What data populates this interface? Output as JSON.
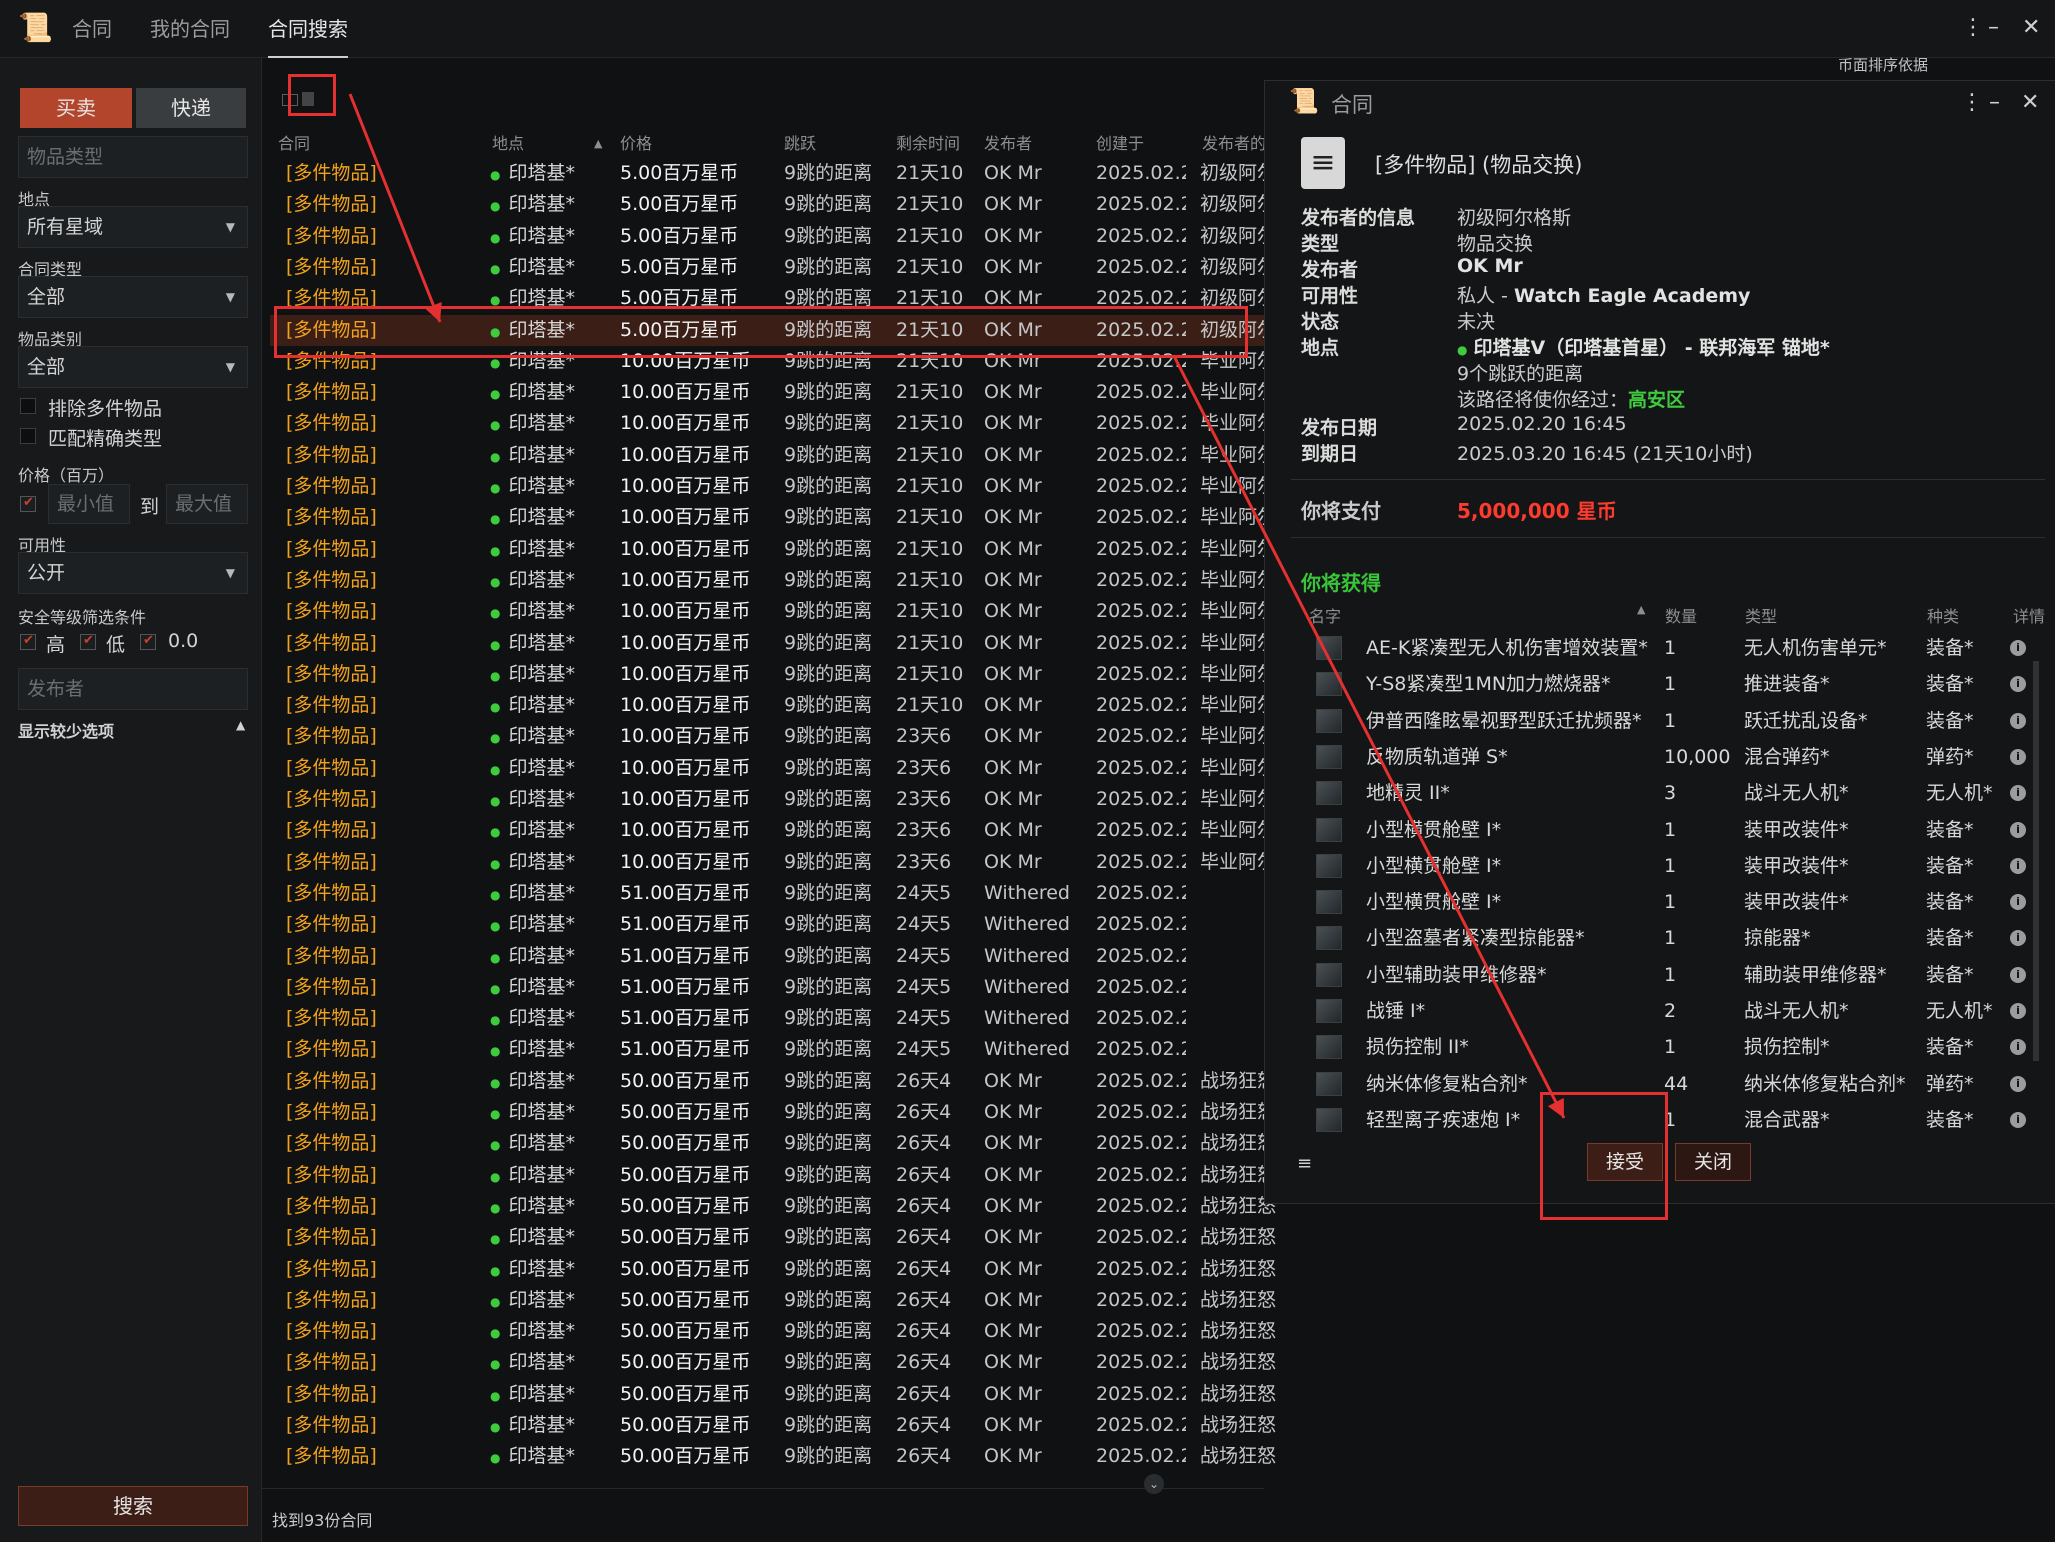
{
  "app": {
    "tabs": [
      "合同",
      "我的合同",
      "合同搜索"
    ],
    "window_controls": [
      "⋮",
      "–",
      "✕"
    ],
    "sort_hint": "币面排序依据"
  },
  "sidebar": {
    "mode_buy": "买卖",
    "mode_courier": "快递",
    "item_type_placeholder": "物品类型",
    "location_label": "地点",
    "location_value": "所有星域",
    "contract_type_label": "合同类型",
    "contract_type_value": "全部",
    "item_category_label": "物品类别",
    "item_category_value": "全部",
    "exclude_multi": "排除多件物品",
    "exact_match": "匹配精确类型",
    "price_label": "价格（百万）",
    "price_min_placeholder": "最小值",
    "price_to": "到",
    "price_max_placeholder": "最大值",
    "availability_label": "可用性",
    "availability_value": "公开",
    "security_label": "安全等级筛选条件",
    "sec_high": "高",
    "sec_low": "低",
    "sec_null": "0.0",
    "issuer_placeholder": "发布者",
    "fewer_options": "显示较少选项",
    "search_button": "搜索"
  },
  "table": {
    "headers": [
      "合同",
      "地点",
      "价格",
      "跳跃",
      "剩余时间",
      "发布者",
      "创建于",
      "发布者的"
    ],
    "rows": [
      [
        "[多件物品]",
        "印塔基*",
        "5.00百万星币",
        "9跳的距离",
        "21天10",
        "OK Mr",
        "2025.02.2",
        "初级阿尔"
      ],
      [
        "[多件物品]",
        "印塔基*",
        "5.00百万星币",
        "9跳的距离",
        "21天10",
        "OK Mr",
        "2025.02.2",
        "初级阿尔"
      ],
      [
        "[多件物品]",
        "印塔基*",
        "5.00百万星币",
        "9跳的距离",
        "21天10",
        "OK Mr",
        "2025.02.2",
        "初级阿尔"
      ],
      [
        "[多件物品]",
        "印塔基*",
        "5.00百万星币",
        "9跳的距离",
        "21天10",
        "OK Mr",
        "2025.02.2",
        "初级阿尔"
      ],
      [
        "[多件物品]",
        "印塔基*",
        "5.00百万星币",
        "9跳的距离",
        "21天10",
        "OK Mr",
        "2025.02.2",
        "初级阿尔"
      ],
      [
        "[多件物品]",
        "印塔基*",
        "5.00百万星币",
        "9跳的距离",
        "21天10",
        "OK Mr",
        "2025.02.2",
        "初级阿尔"
      ],
      [
        "[多件物品]",
        "印塔基*",
        "10.00百万星币",
        "9跳的距离",
        "21天10",
        "OK Mr",
        "2025.02.2",
        "毕业阿尔"
      ],
      [
        "[多件物品]",
        "印塔基*",
        "10.00百万星币",
        "9跳的距离",
        "21天10",
        "OK Mr",
        "2025.02.2",
        "毕业阿尔"
      ],
      [
        "[多件物品]",
        "印塔基*",
        "10.00百万星币",
        "9跳的距离",
        "21天10",
        "OK Mr",
        "2025.02.2",
        "毕业阿尔"
      ],
      [
        "[多件物品]",
        "印塔基*",
        "10.00百万星币",
        "9跳的距离",
        "21天10",
        "OK Mr",
        "2025.02.2",
        "毕业阿尔"
      ],
      [
        "[多件物品]",
        "印塔基*",
        "10.00百万星币",
        "9跳的距离",
        "21天10",
        "OK Mr",
        "2025.02.2",
        "毕业阿尔"
      ],
      [
        "[多件物品]",
        "印塔基*",
        "10.00百万星币",
        "9跳的距离",
        "21天10",
        "OK Mr",
        "2025.02.2",
        "毕业阿尔"
      ],
      [
        "[多件物品]",
        "印塔基*",
        "10.00百万星币",
        "9跳的距离",
        "21天10",
        "OK Mr",
        "2025.02.2",
        "毕业阿尔"
      ],
      [
        "[多件物品]",
        "印塔基*",
        "10.00百万星币",
        "9跳的距离",
        "21天10",
        "OK Mr",
        "2025.02.2",
        "毕业阿尔"
      ],
      [
        "[多件物品]",
        "印塔基*",
        "10.00百万星币",
        "9跳的距离",
        "21天10",
        "OK Mr",
        "2025.02.2",
        "毕业阿尔"
      ],
      [
        "[多件物品]",
        "印塔基*",
        "10.00百万星币",
        "9跳的距离",
        "21天10",
        "OK Mr",
        "2025.02.2",
        "毕业阿尔"
      ],
      [
        "[多件物品]",
        "印塔基*",
        "10.00百万星币",
        "9跳的距离",
        "21天10",
        "OK Mr",
        "2025.02.2",
        "毕业阿尔"
      ],
      [
        "[多件物品]",
        "印塔基*",
        "10.00百万星币",
        "9跳的距离",
        "21天10",
        "OK Mr",
        "2025.02.2",
        "毕业阿尔"
      ],
      [
        "[多件物品]",
        "印塔基*",
        "10.00百万星币",
        "9跳的距离",
        "23天6",
        "OK Mr",
        "2025.02.2",
        "毕业阿尔"
      ],
      [
        "[多件物品]",
        "印塔基*",
        "10.00百万星币",
        "9跳的距离",
        "23天6",
        "OK Mr",
        "2025.02.2",
        "毕业阿尔"
      ],
      [
        "[多件物品]",
        "印塔基*",
        "10.00百万星币",
        "9跳的距离",
        "23天6",
        "OK Mr",
        "2025.02.2",
        "毕业阿尔"
      ],
      [
        "[多件物品]",
        "印塔基*",
        "10.00百万星币",
        "9跳的距离",
        "23天6",
        "OK Mr",
        "2025.02.2",
        "毕业阿尔"
      ],
      [
        "[多件物品]",
        "印塔基*",
        "10.00百万星币",
        "9跳的距离",
        "23天6",
        "OK Mr",
        "2025.02.2",
        "毕业阿尔"
      ],
      [
        "[多件物品]",
        "印塔基*",
        "51.00百万星币",
        "9跳的距离",
        "24天5",
        "Withered",
        "2025.02.2",
        ""
      ],
      [
        "[多件物品]",
        "印塔基*",
        "51.00百万星币",
        "9跳的距离",
        "24天5",
        "Withered",
        "2025.02.2",
        ""
      ],
      [
        "[多件物品]",
        "印塔基*",
        "51.00百万星币",
        "9跳的距离",
        "24天5",
        "Withered",
        "2025.02.2",
        ""
      ],
      [
        "[多件物品]",
        "印塔基*",
        "51.00百万星币",
        "9跳的距离",
        "24天5",
        "Withered",
        "2025.02.2",
        ""
      ],
      [
        "[多件物品]",
        "印塔基*",
        "51.00百万星币",
        "9跳的距离",
        "24天5",
        "Withered",
        "2025.02.2",
        ""
      ],
      [
        "[多件物品]",
        "印塔基*",
        "51.00百万星币",
        "9跳的距离",
        "24天5",
        "Withered",
        "2025.02.2",
        ""
      ],
      [
        "[多件物品]",
        "印塔基*",
        "50.00百万星币",
        "9跳的距离",
        "26天4",
        "OK Mr",
        "2025.02.2",
        "战场狂怒"
      ],
      [
        "[多件物品]",
        "印塔基*",
        "50.00百万星币",
        "9跳的距离",
        "26天4",
        "OK Mr",
        "2025.02.2",
        "战场狂怒"
      ],
      [
        "[多件物品]",
        "印塔基*",
        "50.00百万星币",
        "9跳的距离",
        "26天4",
        "OK Mr",
        "2025.02.2",
        "战场狂怒"
      ],
      [
        "[多件物品]",
        "印塔基*",
        "50.00百万星币",
        "9跳的距离",
        "26天4",
        "OK Mr",
        "2025.02.2",
        "战场狂怒"
      ],
      [
        "[多件物品]",
        "印塔基*",
        "50.00百万星币",
        "9跳的距离",
        "26天4",
        "OK Mr",
        "2025.02.2",
        "战场狂怒"
      ],
      [
        "[多件物品]",
        "印塔基*",
        "50.00百万星币",
        "9跳的距离",
        "26天4",
        "OK Mr",
        "2025.02.2",
        "战场狂怒"
      ],
      [
        "[多件物品]",
        "印塔基*",
        "50.00百万星币",
        "9跳的距离",
        "26天4",
        "OK Mr",
        "2025.02.2",
        "战场狂怒"
      ],
      [
        "[多件物品]",
        "印塔基*",
        "50.00百万星币",
        "9跳的距离",
        "26天4",
        "OK Mr",
        "2025.02.2",
        "战场狂怒"
      ],
      [
        "[多件物品]",
        "印塔基*",
        "50.00百万星币",
        "9跳的距离",
        "26天4",
        "OK Mr",
        "2025.02.2",
        "战场狂怒"
      ],
      [
        "[多件物品]",
        "印塔基*",
        "50.00百万星币",
        "9跳的距离",
        "26天4",
        "OK Mr",
        "2025.02.2",
        "战场狂怒"
      ],
      [
        "[多件物品]",
        "印塔基*",
        "50.00百万星币",
        "9跳的距离",
        "26天4",
        "OK Mr",
        "2025.02.2",
        "战场狂怒"
      ],
      [
        "[多件物品]",
        "印塔基*",
        "50.00百万星币",
        "9跳的距离",
        "26天4",
        "OK Mr",
        "2025.02.2",
        "战场狂怒"
      ],
      [
        "[多件物品]",
        "印塔基*",
        "50.00百万星币",
        "9跳的距离",
        "26天4",
        "OK Mr",
        "2025.02.2",
        "战场狂怒"
      ]
    ],
    "found_text": "找到93份合同"
  },
  "panel": {
    "title": "合同",
    "contract_name": "[多件物品] (物品交换)",
    "labels": {
      "issuer_info": "发布者的信息",
      "type": "类型",
      "issuer": "发布者",
      "availability": "可用性",
      "status": "状态",
      "location": "地点",
      "issued": "发布日期",
      "expires": "到期日"
    },
    "values": {
      "issuer_info": "初级阿尔格斯",
      "type": "物品交换",
      "issuer": "OK Mr",
      "availability_prefix": "私人 - ",
      "availability_corp": "Watch Eagle Academy",
      "status": "未决",
      "location": "印塔基V（印塔基首星） - 联邦海军 锚地*",
      "jumps": "9个跳跃的距离",
      "route_prefix": "该路径将使你经过：",
      "route_sec": "高安区",
      "issued": "2025.02.20 16:45",
      "expires": "2025.03.20 16:45 (21天10小时)"
    },
    "pay_label": "你将支付",
    "pay_value": "5,000,000 星币",
    "get_label": "你将获得",
    "item_headers": [
      "名字",
      "数量",
      "类型",
      "种类",
      "详情"
    ],
    "items": [
      [
        "AE-K紧凑型无人机伤害增效装置*",
        "1",
        "无人机伤害单元*",
        "装备*"
      ],
      [
        "Y-S8紧凑型1MN加力燃烧器*",
        "1",
        "推进装备*",
        "装备*"
      ],
      [
        "伊普西隆眩晕视野型跃迁扰频器*",
        "1",
        "跃迁扰乱设备*",
        "装备*"
      ],
      [
        "反物质轨道弹 S*",
        "10,000",
        "混合弹药*",
        "弹药*"
      ],
      [
        "地精灵 II*",
        "3",
        "战斗无人机*",
        "无人机*"
      ],
      [
        "小型横贯舱壁 I*",
        "1",
        "装甲改装件*",
        "装备*"
      ],
      [
        "小型横贯舱壁 I*",
        "1",
        "装甲改装件*",
        "装备*"
      ],
      [
        "小型横贯舱壁 I*",
        "1",
        "装甲改装件*",
        "装备*"
      ],
      [
        "小型盗墓者紧凑型掠能器*",
        "1",
        "掠能器*",
        "装备*"
      ],
      [
        "小型辅助装甲维修器*",
        "1",
        "辅助装甲维修器*",
        "装备*"
      ],
      [
        "战锤 I*",
        "2",
        "战斗无人机*",
        "无人机*"
      ],
      [
        "损伤控制 II*",
        "1",
        "损伤控制*",
        "装备*"
      ],
      [
        "纳米体修复粘合剂*",
        "44",
        "纳米体修复粘合剂*",
        "弹药*"
      ],
      [
        "轻型离子疾速炮 I*",
        "1",
        "混合武器*",
        "装备*"
      ]
    ],
    "accept_button": "接受",
    "close_button": "关闭"
  },
  "colors": {
    "accent": "#c9422a",
    "orange": "#f1a11c",
    "green": "#3ecb3e",
    "red": "#ff3b2f",
    "annotation": "#e43030"
  }
}
